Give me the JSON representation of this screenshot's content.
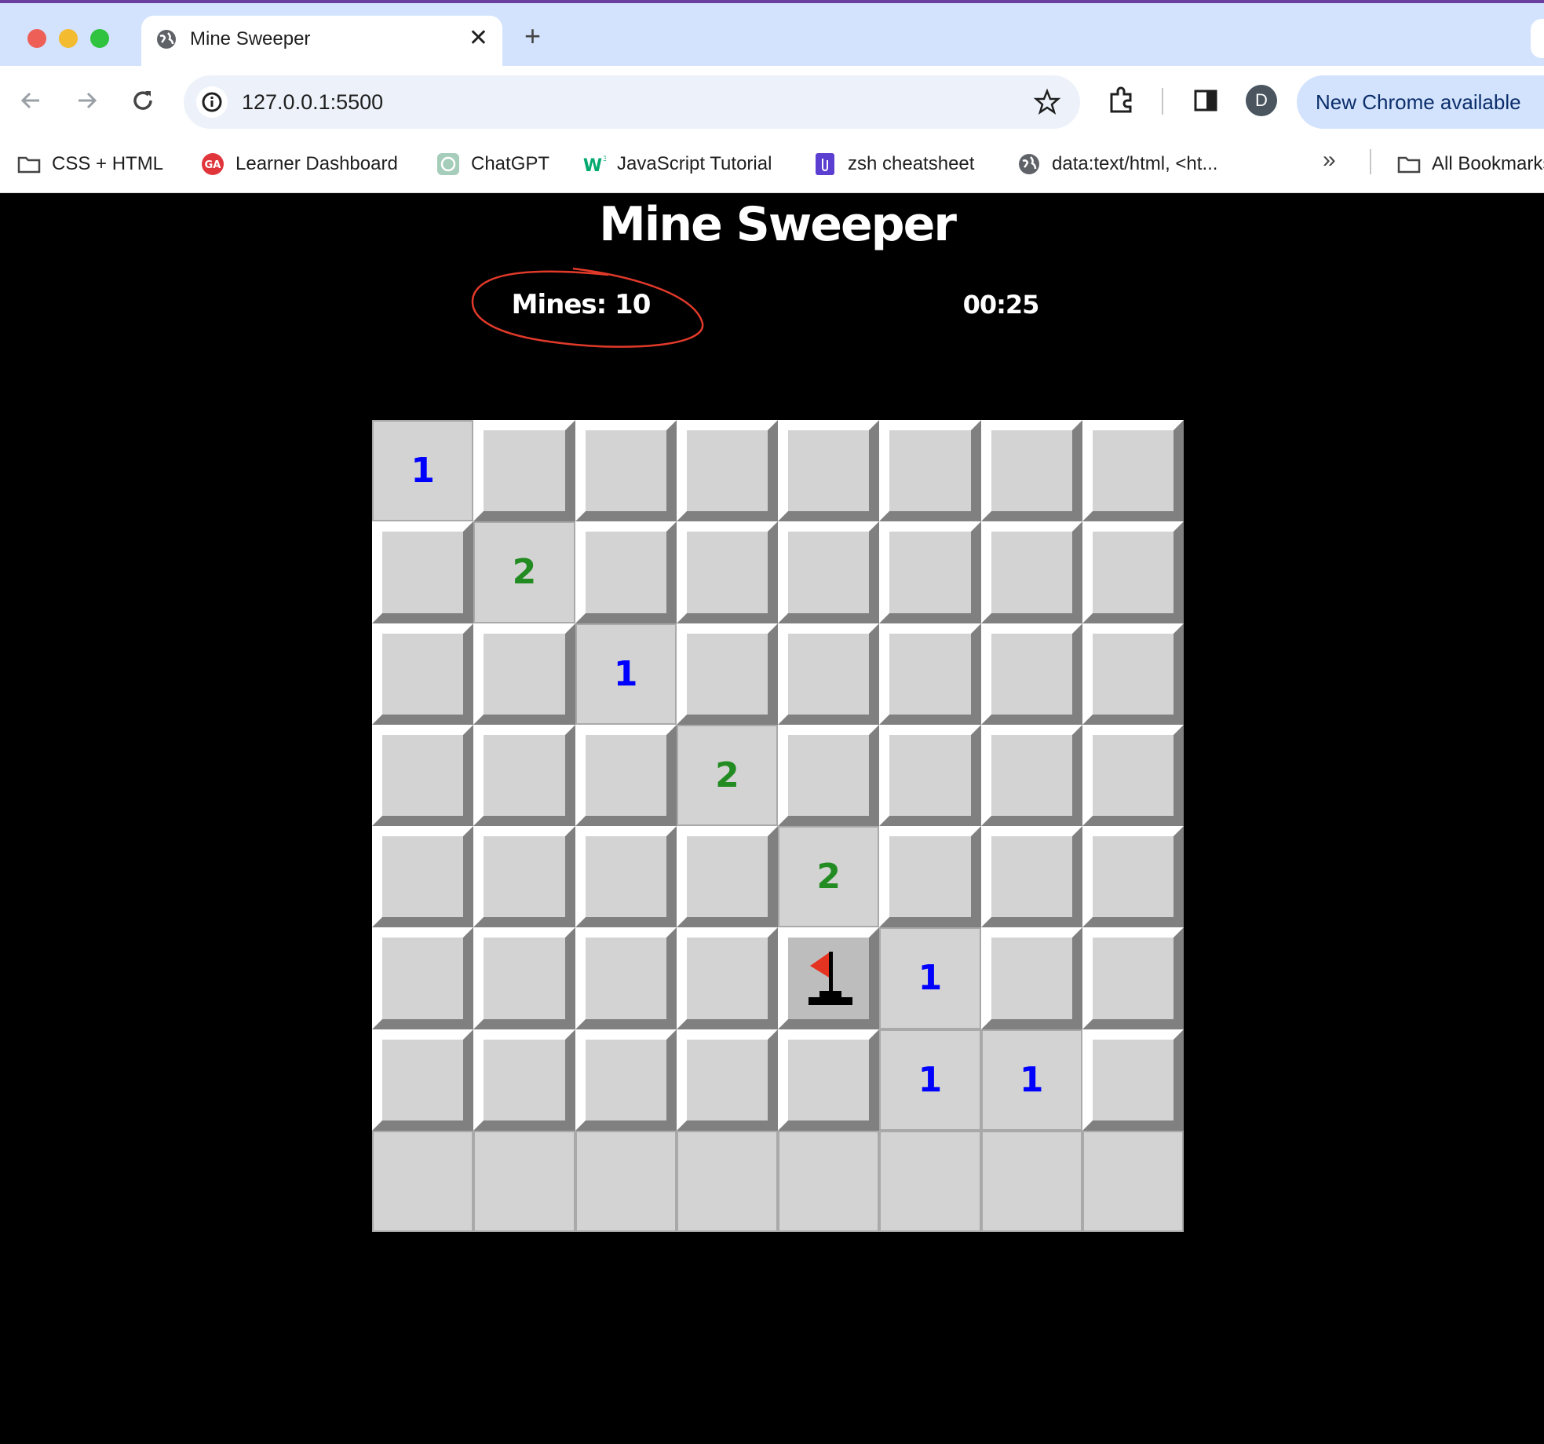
{
  "browser": {
    "tab_title": "Mine Sweeper",
    "tab_close": "✕",
    "new_tab": "+",
    "url": "127.0.0.1:5500",
    "profile_initial": "D",
    "update_label": "New Chrome available",
    "bookmarks": [
      {
        "label": "CSS + HTML",
        "icon": "folder-icon"
      },
      {
        "label": "Learner Dashboard",
        "icon": "ga-logo-icon"
      },
      {
        "label": "ChatGPT",
        "icon": "chatgpt-icon"
      },
      {
        "label": "JavaScript Tutorial",
        "icon": "w3schools-icon"
      },
      {
        "label": "zsh cheatsheet",
        "icon": "paperclip-icon"
      },
      {
        "label": "data:text/html, <ht...",
        "icon": "globe-icon"
      }
    ],
    "more_bookmarks": "»",
    "all_bookmarks": "All Bookmarks"
  },
  "game": {
    "title": "Mine Sweeper",
    "mines_label": "Mines: 10",
    "timer": "00:25",
    "rows": 8,
    "cols": 8,
    "board": [
      [
        "1",
        "#",
        "#",
        "#",
        "#",
        "#",
        "#",
        "#"
      ],
      [
        "#",
        "2",
        "#",
        "#",
        "#",
        "#",
        "#",
        "#"
      ],
      [
        "#",
        "#",
        "1",
        "#",
        "#",
        "#",
        "#",
        "#"
      ],
      [
        "#",
        "#",
        "#",
        "2",
        "#",
        "#",
        "#",
        "#"
      ],
      [
        "#",
        "#",
        "#",
        "#",
        "2",
        "#",
        "#",
        "#"
      ],
      [
        "#",
        "#",
        "#",
        "#",
        "F",
        "1",
        "#",
        "#"
      ],
      [
        "#",
        "#",
        "#",
        "#",
        "#",
        "1",
        "1",
        "#"
      ],
      [
        "",
        "",
        "",
        "",
        "",
        "",
        "",
        ""
      ]
    ],
    "legend": {
      "#": "covered",
      "F": "flagged",
      "": "revealed-empty"
    }
  },
  "colors": {
    "number_1": "#0000ff",
    "number_2": "#228b22",
    "annotation": "#e23a2a",
    "flag": "#e53322"
  }
}
